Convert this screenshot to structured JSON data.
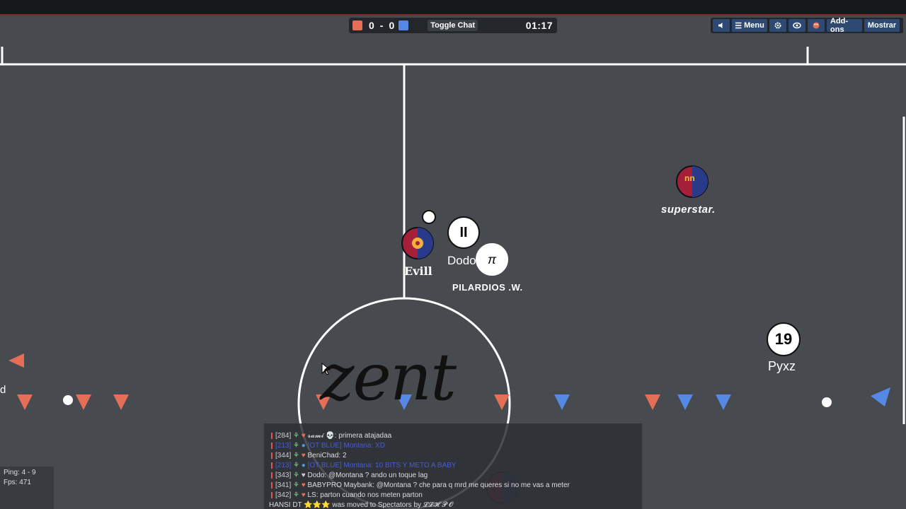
{
  "hud": {
    "score_red": "0",
    "score_sep": "-",
    "score_blue": "0",
    "toggle_chat": "Toggle Chat",
    "timer": "01:17",
    "colors": {
      "red": "#e56e56",
      "blue": "#5689e5"
    }
  },
  "menubar": {
    "sound_icon": "speaker-icon",
    "menu_label": "Menu",
    "settings_icon": "gear-icon",
    "view_icon": "eye-icon",
    "palette_icon": "palette-icon",
    "addons_label": "Add-ons",
    "mostrar_label": "Mostrar"
  },
  "players": {
    "evill": {
      "name": "Evill"
    },
    "dodo": {
      "name": "Dodo",
      "avatar": "II"
    },
    "pilardios": {
      "name": "PILARDIOS .W.",
      "avatar": "π"
    },
    "superstar": {
      "name": "superstar.",
      "avatar": "nn"
    },
    "pyxz": {
      "name": "Pyxz",
      "avatar": "19"
    },
    "left_cut": {
      "name": "d"
    }
  },
  "overlay_text": "zent",
  "chat": {
    "lines": [
      {
        "idx": "[284]",
        "name": "𝓻𝓪𝓶𝓲 💀",
        "msg": ": primera atajadaa"
      },
      {
        "idx": "[213]",
        "name": "[OT BLUE] Montana",
        "msg": ": XD"
      },
      {
        "idx": "[344]",
        "name": "BeniChad",
        "msg": ": 2"
      },
      {
        "idx": "[213]",
        "name": "[OT BLUE] Montana",
        "msg": ": 10 BITS Y METO A BABY"
      },
      {
        "idx": "[343]",
        "name": "Dodo",
        "msg": ": @Montana ? ando un toque lag"
      },
      {
        "idx": "[341]",
        "name": "BABYPRO Maybank",
        "msg": ": @Montana ? che para q mrd me queres si no me vas a meter"
      },
      {
        "idx": "[342]",
        "name": "LS",
        "msg": ": parton cuando nos meten parton"
      }
    ],
    "system": "HANSI DT ⭐⭐⭐ was moved to Spectators by 𝓛𝓛𝓗 𝓟 𝓞"
  },
  "stats": {
    "ping": "Ping: 4 - 9",
    "fps": "Fps: 471"
  }
}
